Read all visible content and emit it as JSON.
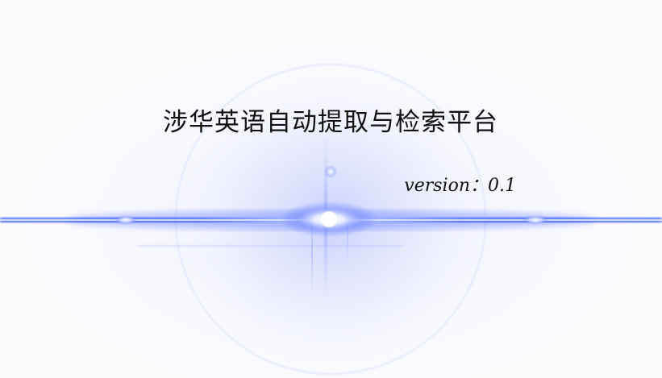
{
  "app": {
    "title": "涉华英语自动提取与检索平台",
    "version_label": "version：0.1"
  },
  "colors": {
    "background": "#fbfbfe",
    "flare_core": "#ffffff",
    "flare_blue": "#3c5cff",
    "text": "#111111"
  }
}
